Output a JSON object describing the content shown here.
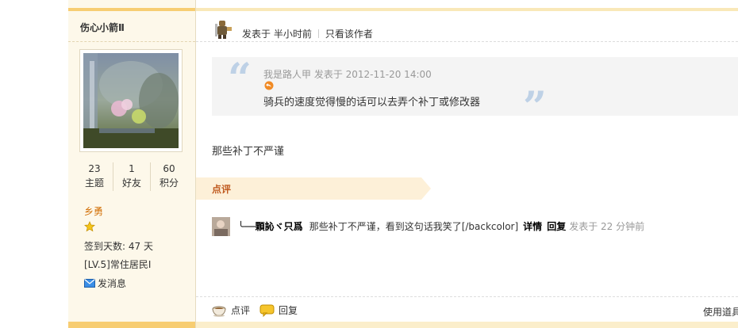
{
  "sidebar": {
    "username": "伤心小箭Ⅱ",
    "stats": [
      {
        "value": "23",
        "label": "主题"
      },
      {
        "value": "1",
        "label": "好友"
      },
      {
        "value": "60",
        "label": "积分"
      }
    ],
    "rank": "乡勇",
    "checkin_days": "签到天数: 47 天",
    "level": "[LV.5]常住居民I",
    "send_message": "发消息"
  },
  "post": {
    "posted_at": "发表于 半小时前",
    "only_author": "只看该作者",
    "quote": {
      "meta": "我是路人甲 发表于 2012-11-20 14:00",
      "text": "骑兵的速度觉得慢的话可以去弄个补丁或修改器"
    },
    "body": "那些补丁不严谨"
  },
  "comments": {
    "tab_label": "点评",
    "items": [
      {
        "user": "╰──顆訫ヾ只爲",
        "text": "那些补丁不严谨，看到这句话我笑了[/backcolor]",
        "detail": "详情",
        "reply": "回复",
        "time": "发表于 22 分钟前"
      }
    ]
  },
  "actions": {
    "comment": "点评",
    "reply": "回复",
    "use_tool": "使用道具"
  },
  "colors": {
    "sidebar_bg": "#fdf8ea",
    "band": "#f7cd72",
    "rank": "#d26f06",
    "comment_tab": "#c05a1f",
    "quote_mark": "#bed1e6"
  }
}
